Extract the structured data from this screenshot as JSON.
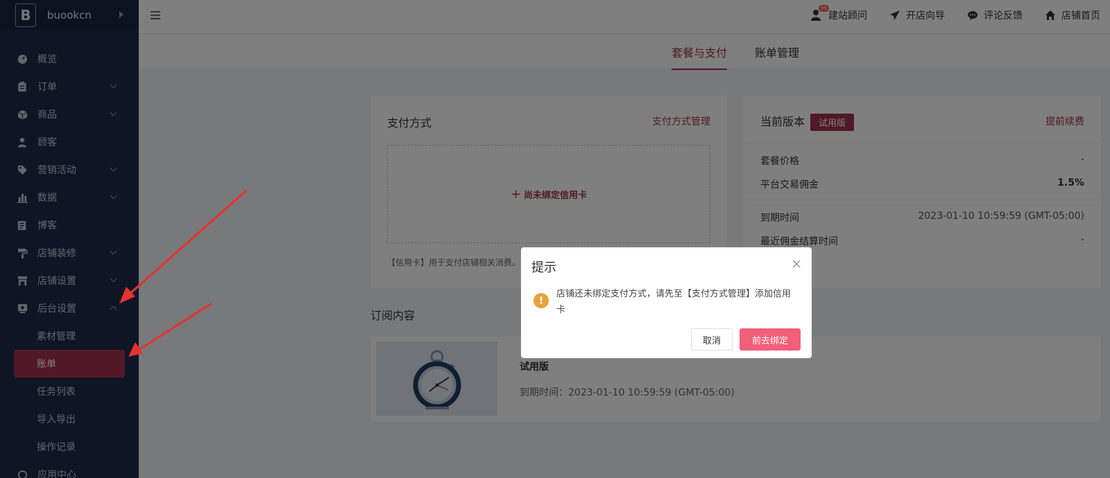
{
  "brand": {
    "logo_letter": "B",
    "name": "buookcn"
  },
  "sidebar": {
    "items": [
      {
        "label": "概览",
        "icon": "dashboard-icon",
        "expandable": false
      },
      {
        "label": "订单",
        "icon": "clipboard-icon",
        "expandable": true
      },
      {
        "label": "商品",
        "icon": "box-icon",
        "expandable": true
      },
      {
        "label": "顾客",
        "icon": "user-icon",
        "expandable": false
      },
      {
        "label": "营销活动",
        "icon": "tag-icon",
        "expandable": true
      },
      {
        "label": "数据",
        "icon": "bar-chart-icon",
        "expandable": true
      },
      {
        "label": "博客",
        "icon": "edit-icon",
        "expandable": false
      },
      {
        "label": "店铺装修",
        "icon": "paint-roller-icon",
        "expandable": true
      },
      {
        "label": "店铺设置",
        "icon": "store-icon",
        "expandable": true
      },
      {
        "label": "后台设置",
        "icon": "settings-panel-icon",
        "expandable": true,
        "expanded": true
      }
    ],
    "sub_items": [
      {
        "label": "素材管理"
      },
      {
        "label": "账单",
        "active": true
      },
      {
        "label": "任务列表"
      },
      {
        "label": "导入导出"
      },
      {
        "label": "操作记录"
      }
    ],
    "last_item": {
      "label": "应用中心",
      "icon": "apps-icon"
    }
  },
  "topbar": {
    "links": [
      {
        "label": "建站顾问",
        "icon": "consultant-icon",
        "badge": "99"
      },
      {
        "label": "开店向导",
        "icon": "paper-plane-icon"
      },
      {
        "label": "评论反馈",
        "icon": "chat-bubble-icon"
      },
      {
        "label": "店铺首页",
        "icon": "home-icon"
      }
    ]
  },
  "tabs": [
    {
      "label": "套餐与支付",
      "active": true
    },
    {
      "label": "账单管理",
      "active": false
    }
  ],
  "payment": {
    "title": "支付方式",
    "manage_link": "支付方式管理",
    "empty_label": "尚未绑定信用卡",
    "hint": "【信用卡】用于支付店铺相关消费。"
  },
  "version": {
    "title": "当前版本",
    "badge": "试用版",
    "renew_link": "提前续费",
    "rows": [
      {
        "label": "套餐价格",
        "value": "-"
      },
      {
        "label": "平台交易佣金",
        "value": "1.5%"
      },
      {
        "label": "到期时间",
        "value": "2023-01-10 10:59:59 (GMT-05:00)"
      },
      {
        "label": "最近佣金结算时间",
        "value": "-"
      }
    ]
  },
  "subscription": {
    "title": "订阅内容",
    "plan_name": "试用版",
    "expiry": "到期时间：2023-01-10 10:59:59 (GMT-05:00)"
  },
  "dialog": {
    "title": "提示",
    "message": "店铺还未绑定支付方式，请先至【支付方式管理】添加信用卡",
    "cancel_label": "取消",
    "confirm_label": "前去绑定"
  },
  "colors": {
    "sidebar_bg": "#1e2b4a",
    "accent": "#a3314f",
    "confirm_button": "#f25f78",
    "warning": "#e6a23c",
    "annotation_arrow": "#e8322f"
  }
}
